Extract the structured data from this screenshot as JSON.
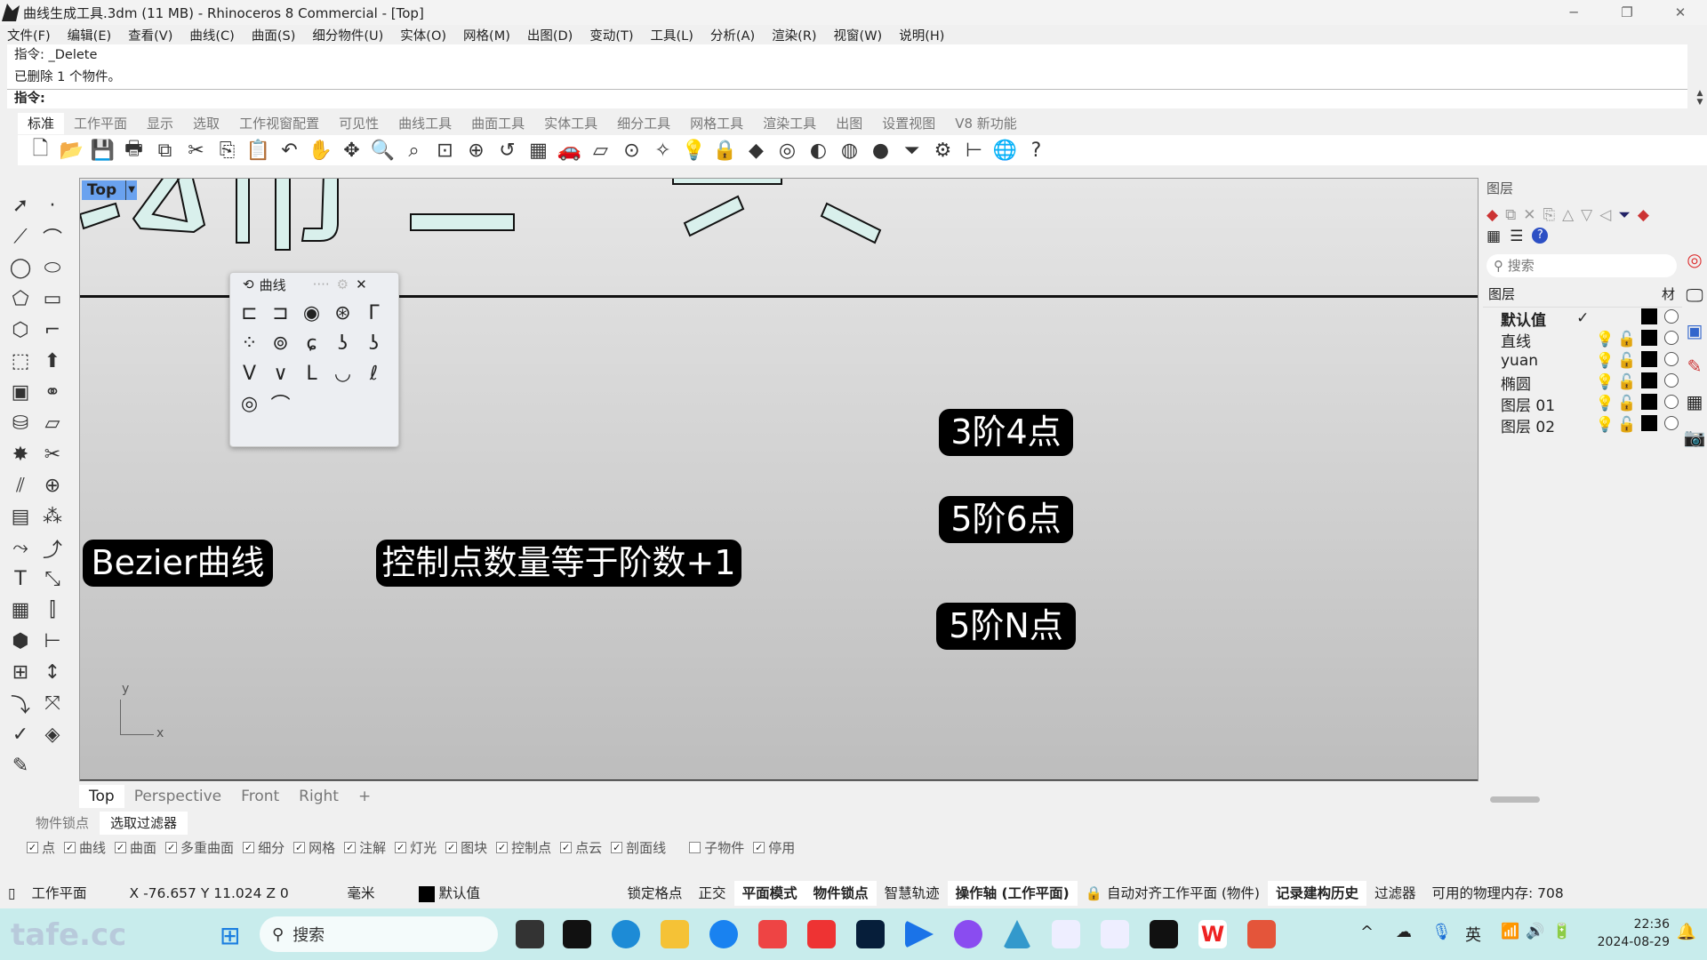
{
  "window": {
    "title": "曲线生成工具.3dm (11 MB) - Rhinoceros 8 Commercial - [Top]",
    "minimize": "─",
    "restore": "❐",
    "close": "✕"
  },
  "menu": [
    "文件(F)",
    "编辑(E)",
    "查看(V)",
    "曲线(C)",
    "曲面(S)",
    "细分物件(U)",
    "实体(O)",
    "网格(M)",
    "出图(D)",
    "变动(T)",
    "工具(L)",
    "分析(A)",
    "渲染(R)",
    "视窗(W)",
    "说明(H)"
  ],
  "command": {
    "history": [
      "指令: _Delete",
      "已删除 1 个物件。"
    ],
    "prompt": "指令:"
  },
  "toolbar_tabs": [
    "标准",
    "工作平面",
    "显示",
    "选取",
    "工作视窗配置",
    "可见性",
    "曲线工具",
    "曲面工具",
    "实体工具",
    "细分工具",
    "网格工具",
    "渲染工具",
    "出图",
    "设置视图",
    "V8 新功能"
  ],
  "toolbar_icons": [
    [
      "new-file-icon",
      "🗋"
    ],
    [
      "open-icon",
      "📂"
    ],
    [
      "save-icon",
      "💾"
    ],
    [
      "print-icon",
      "🖶"
    ],
    [
      "import-icon",
      "⧉"
    ],
    [
      "cut-icon",
      "✂"
    ],
    [
      "copy-icon",
      "⎘"
    ],
    [
      "paste-icon",
      "📋"
    ],
    [
      "undo-icon",
      "↶"
    ],
    [
      "pan-icon",
      "✋"
    ],
    [
      "rotate-view-icon",
      "✥"
    ],
    [
      "zoom-icon",
      "🔍"
    ],
    [
      "zoom-window-icon",
      "⌕"
    ],
    [
      "zoom-extents-icon",
      "⊡"
    ],
    [
      "zoom-selected-icon",
      "⊕"
    ],
    [
      "undo-view-icon",
      "↺"
    ],
    [
      "four-views-icon",
      "▦"
    ],
    [
      "car-icon",
      "🚗"
    ],
    [
      "plane-icon",
      "▱"
    ],
    [
      "gumball-icon",
      "⊙"
    ],
    [
      "snap-icon",
      "✧"
    ],
    [
      "light-icon",
      "💡"
    ],
    [
      "lock-icon",
      "🔒"
    ],
    [
      "layer-icon",
      "◆"
    ],
    [
      "color-wheel-icon",
      "◎"
    ],
    [
      "shade-icon",
      "◐"
    ],
    [
      "rendered-icon",
      "◍"
    ],
    [
      "render-sphere-icon",
      "●"
    ],
    [
      "filter-icon",
      "⏷"
    ],
    [
      "gear-icon",
      "⚙"
    ],
    [
      "dimension-icon",
      "⊢"
    ],
    [
      "globe-icon",
      "🌐"
    ],
    [
      "help-icon",
      "?"
    ]
  ],
  "left_tools": [
    "select-arrow-icon",
    "point-icon",
    "polyline-icon",
    "curve-icon",
    "circle-icon",
    "ellipse-icon",
    "polygon-icon",
    "rectangle-icon",
    "hexagon-icon",
    "fillet-icon",
    "surface-icon",
    "extrude-icon",
    "box-icon",
    "boolean-icon",
    "cylinder-icon",
    "plane-surface-icon",
    "explode-icon",
    "trim-icon",
    "split-icon",
    "join-icon",
    "group-icon",
    "cluster-icon",
    "offset-icon",
    "blend-icon",
    "text-icon",
    "scale-icon",
    "array-icon",
    "mirror-icon",
    "mesh-icon",
    "dimension-icon",
    "grid-array-icon",
    "align-icon",
    "bend-icon",
    "transform-icon",
    "check-icon",
    "analyze-icon",
    "paint-icon"
  ],
  "viewport": {
    "name": "Top",
    "labels": {
      "bezier": "Bezier曲线",
      "rule": "控制点数量等于阶数+1",
      "deg3": "3阶4点",
      "deg5a": "5阶6点",
      "deg5n": "5阶N点"
    },
    "axis_x": "x",
    "axis_y": "y"
  },
  "curve_panel": {
    "title": "曲线",
    "icons": [
      "control-point-curve-icon",
      "interp-curve-icon",
      "circle-fit-icon",
      "sketch-curve-icon",
      "arc-blend-icon",
      "rebuild-curve-icon",
      "sphere-points-icon",
      "spiral-icon",
      "handle-curve-icon",
      "conic-icon",
      "parabola-icon",
      "parabola-focus-icon",
      "catenary-icon",
      "dashed-curve-icon",
      "helix-icon",
      "spiral-target-icon",
      "arc-stack-icon"
    ]
  },
  "viewport_tabs": [
    "Top",
    "Perspective",
    "Front",
    "Right",
    "+"
  ],
  "layers": {
    "title": "图层",
    "search_placeholder": "搜索",
    "col_name": "图层",
    "col_material": "材",
    "rows": [
      {
        "name": "默认值",
        "current": true
      },
      {
        "name": "直线"
      },
      {
        "name": "yuan"
      },
      {
        "name": "椭圆"
      },
      {
        "name": "图层 01"
      },
      {
        "name": "图层 02"
      }
    ]
  },
  "bottom_tabs": [
    "物件锁点",
    "选取过滤器"
  ],
  "filters": [
    {
      "label": "点",
      "checked": true
    },
    {
      "label": "曲线",
      "checked": true
    },
    {
      "label": "曲面",
      "checked": true
    },
    {
      "label": "多重曲面",
      "checked": true
    },
    {
      "label": "细分",
      "checked": true
    },
    {
      "label": "网格",
      "checked": true
    },
    {
      "label": "注解",
      "checked": true
    },
    {
      "label": "灯光",
      "checked": true
    },
    {
      "label": "图块",
      "checked": true
    },
    {
      "label": "控制点",
      "checked": true
    },
    {
      "label": "点云",
      "checked": true
    },
    {
      "label": "剖面线",
      "checked": true
    },
    {
      "label": "子物件",
      "checked": false
    },
    {
      "label": "停用",
      "checked": true
    }
  ],
  "status": {
    "cplane": "工作平面",
    "coords": "X -76.657 Y 11.024 Z 0",
    "units": "毫米",
    "layer": "默认值",
    "grid_snap": "锁定格点",
    "ortho": "正交",
    "planar": "平面模式",
    "osnap": "物件锁点",
    "smarttrack": "智慧轨迹",
    "gumball": "操作轴 (工作平面)",
    "autoalign": "自动对齐工作平面 (物件)",
    "history": "记录建构历史",
    "filter": "过滤器",
    "memory": "可用的物理内存: 708"
  },
  "taskbar": {
    "search": "搜索",
    "time": "22:36",
    "date": "2024-08-29",
    "lang": "英",
    "watermark": "tafe.cc"
  }
}
